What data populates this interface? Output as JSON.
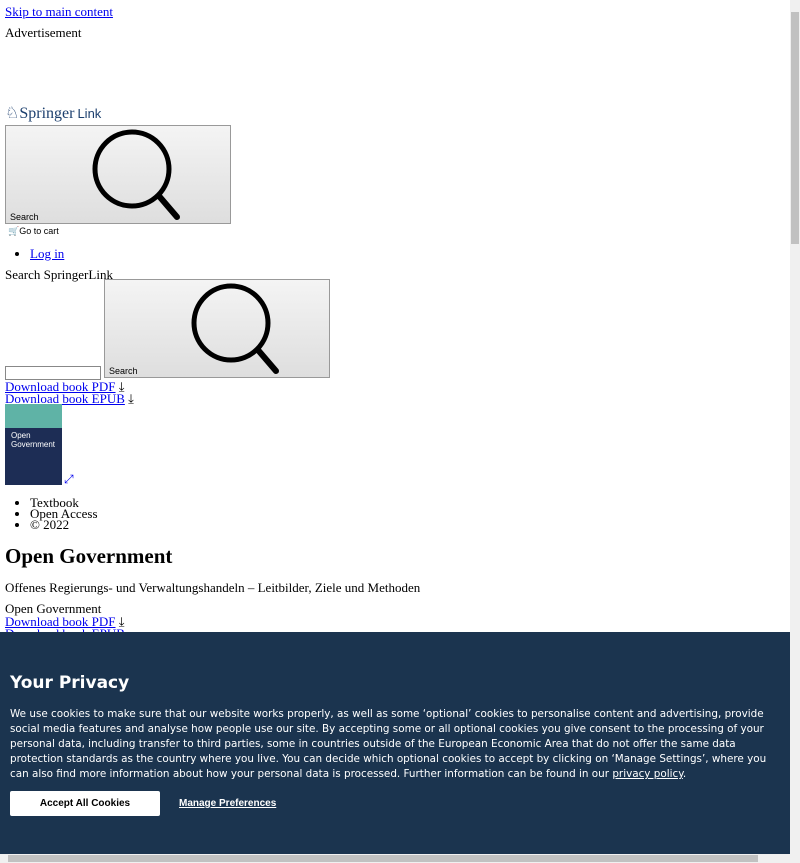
{
  "skip_link": "Skip to main content",
  "advertisement": "Advertisement",
  "logo": {
    "text": "Springer",
    "text2": "Link"
  },
  "header": {
    "search_label": "Search",
    "cart_label": "Go to cart",
    "login": "Log in"
  },
  "search": {
    "label": "Search SpringerLink",
    "input_value": "",
    "button_label": "Search"
  },
  "downloads": {
    "pdf": "Download book PDF",
    "epub": "Download book EPUB"
  },
  "cover": {
    "title": "Open Government"
  },
  "meta": [
    "Textbook",
    "Open Access",
    "© 2022"
  ],
  "book": {
    "title": "Open Government",
    "subtitle": "Offenes Regierungs- und Verwaltungshandeln – Leitbilder, Ziele und Methoden",
    "series_title": "Open Government"
  },
  "cookie": {
    "title": "Your Privacy",
    "text": "We use cookies to make sure that our website works properly, as well as some ‘optional’ cookies to personalise content and advertising, provide social media features and analyse how people use our site. By accepting some or all optional cookies you give consent to the processing of your personal data, including transfer to third parties, some in countries outside of the European Economic Area that do not offer the same data protection standards as the country where you live. You can decide which optional cookies to accept by clicking on ‘Manage Settings’, where you can also find more information about how your personal data is processed. Further information can be found in our ",
    "link": "privacy policy",
    "end": ".",
    "accept": "Accept All Cookies",
    "manage": "Manage Preferences",
    "bg": "#1b344f"
  }
}
